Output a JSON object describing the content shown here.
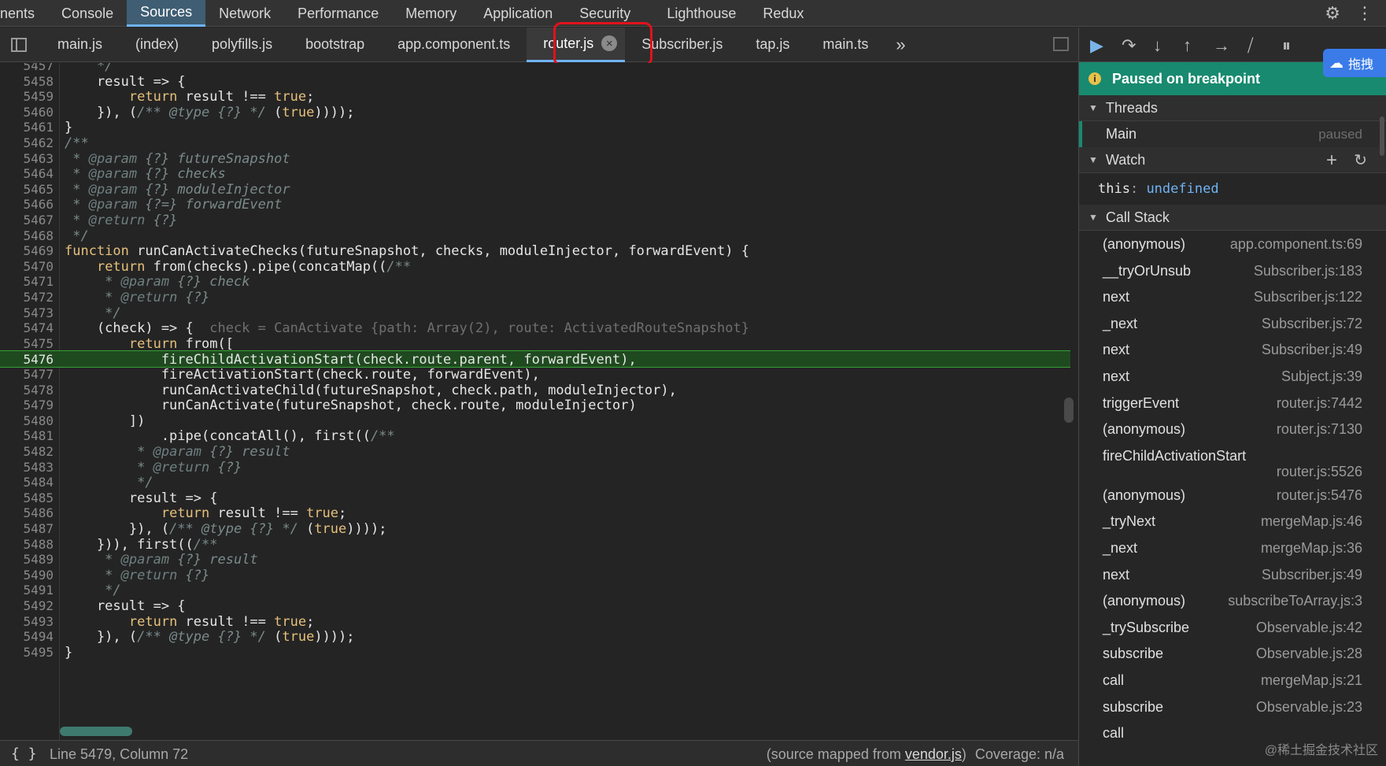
{
  "main_tabs": [
    "nents",
    "Console",
    "Sources",
    "Network",
    "Performance",
    "Memory",
    "Application",
    "Security",
    "Lighthouse",
    "Redux"
  ],
  "active_main_tab": "Sources",
  "file_tabs": [
    "main.js",
    "(index)",
    "polyfills.js",
    "bootstrap",
    "app.component.ts",
    "router.js",
    "Subscriber.js",
    "tap.js",
    "main.ts"
  ],
  "active_file_tab": "router.js",
  "more_tabs_glyph": "»",
  "code_lines": [
    {
      "n": "5457",
      "t": "    */"
    },
    {
      "n": "5458",
      "t": "    result => {"
    },
    {
      "n": "5459",
      "t": "        return result !== true;"
    },
    {
      "n": "5460",
      "t": "    }), (/** @type {?} */ (true))));"
    },
    {
      "n": "5461",
      "t": "}"
    },
    {
      "n": "5462",
      "t": "/**"
    },
    {
      "n": "5463",
      "t": " * @param {?} futureSnapshot"
    },
    {
      "n": "5464",
      "t": " * @param {?} checks"
    },
    {
      "n": "5465",
      "t": " * @param {?} moduleInjector"
    },
    {
      "n": "5466",
      "t": " * @param {?=} forwardEvent"
    },
    {
      "n": "5467",
      "t": " * @return {?}"
    },
    {
      "n": "5468",
      "t": " */"
    },
    {
      "n": "5469",
      "t": "function runCanActivateChecks(futureSnapshot, checks, moduleInjector, forwardEvent) {"
    },
    {
      "n": "5470",
      "t": "    return from(checks).pipe(concatMap((/**"
    },
    {
      "n": "5471",
      "t": "     * @param {?} check"
    },
    {
      "n": "5472",
      "t": "     * @return {?}"
    },
    {
      "n": "5473",
      "t": "     */"
    },
    {
      "n": "5474",
      "t": "    (check) => {",
      "hint": "  check = CanActivate {path: Array(2), route: ActivatedRouteSnapshot}"
    },
    {
      "n": "5475",
      "t": "        return from(["
    },
    {
      "n": "5476",
      "t": "            fireChildActivationStart(check.route.parent, forwardEvent),",
      "highlight": true
    },
    {
      "n": "5477",
      "t": "            fireActivationStart(check.route, forwardEvent),"
    },
    {
      "n": "5478",
      "t": "            runCanActivateChild(futureSnapshot, check.path, moduleInjector),"
    },
    {
      "n": "5479",
      "t": "            runCanActivate(futureSnapshot, check.route, moduleInjector)"
    },
    {
      "n": "5480",
      "t": "        ])"
    },
    {
      "n": "5481",
      "t": "            .pipe(concatAll(), first((/**"
    },
    {
      "n": "5482",
      "t": "         * @param {?} result"
    },
    {
      "n": "5483",
      "t": "         * @return {?}"
    },
    {
      "n": "5484",
      "t": "         */"
    },
    {
      "n": "5485",
      "t": "        result => {"
    },
    {
      "n": "5486",
      "t": "            return result !== true;"
    },
    {
      "n": "5487",
      "t": "        }), (/** @type {?} */ (true))));"
    },
    {
      "n": "5488",
      "t": "    })), first((/**"
    },
    {
      "n": "5489",
      "t": "     * @param {?} result"
    },
    {
      "n": "5490",
      "t": "     * @return {?}"
    },
    {
      "n": "5491",
      "t": "     */"
    },
    {
      "n": "5492",
      "t": "    result => {"
    },
    {
      "n": "5493",
      "t": "        return result !== true;"
    },
    {
      "n": "5494",
      "t": "    }), (/** @type {?} */ (true))));"
    },
    {
      "n": "5495",
      "t": "}"
    }
  ],
  "status": {
    "braces": "{ }",
    "position": "Line 5479, Column 72",
    "mapped_prefix": "(source mapped from ",
    "mapped_link": "vendor.js",
    "mapped_suffix": ")",
    "coverage": "Coverage: n/a"
  },
  "debugger": {
    "paused_text": "Paused on breakpoint",
    "threads_title": "Threads",
    "thread_name": "Main",
    "thread_status": "paused",
    "watch_title": "Watch",
    "watch_key": "this",
    "watch_value": "undefined",
    "callstack_title": "Call Stack",
    "call_stack": [
      {
        "fn": "(anonymous)",
        "loc": "app.component.ts:69"
      },
      {
        "fn": "__tryOrUnsub",
        "loc": "Subscriber.js:183"
      },
      {
        "fn": "next",
        "loc": "Subscriber.js:122"
      },
      {
        "fn": "_next",
        "loc": "Subscriber.js:72"
      },
      {
        "fn": "next",
        "loc": "Subscriber.js:49"
      },
      {
        "fn": "next",
        "loc": "Subject.js:39"
      },
      {
        "fn": "triggerEvent",
        "loc": "router.js:7442"
      },
      {
        "fn": "(anonymous)",
        "loc": "router.js:7130"
      },
      {
        "fn": "fireChildActivationStart",
        "loc": "router.js:5526",
        "tall": true
      },
      {
        "fn": "(anonymous)",
        "loc": "router.js:5476"
      },
      {
        "fn": "_tryNext",
        "loc": "mergeMap.js:46"
      },
      {
        "fn": "_next",
        "loc": "mergeMap.js:36"
      },
      {
        "fn": "next",
        "loc": "Subscriber.js:49"
      },
      {
        "fn": "(anonymous)",
        "loc": "subscribeToArray.js:3"
      },
      {
        "fn": "_trySubscribe",
        "loc": "Observable.js:42"
      },
      {
        "fn": "subscribe",
        "loc": "Observable.js:28"
      },
      {
        "fn": "call",
        "loc": "mergeMap.js:21"
      },
      {
        "fn": "subscribe",
        "loc": "Observable.js:23"
      },
      {
        "fn": "call",
        "loc": ""
      }
    ],
    "baidu_label": "拖拽",
    "watermark": "@稀土掘金技术社区"
  },
  "colors": {
    "accent": "#6fb3f5",
    "paused_bar": "#188a6f",
    "breakpoint_line": "#1f4a1f",
    "highlight_box": "#e0121c"
  }
}
